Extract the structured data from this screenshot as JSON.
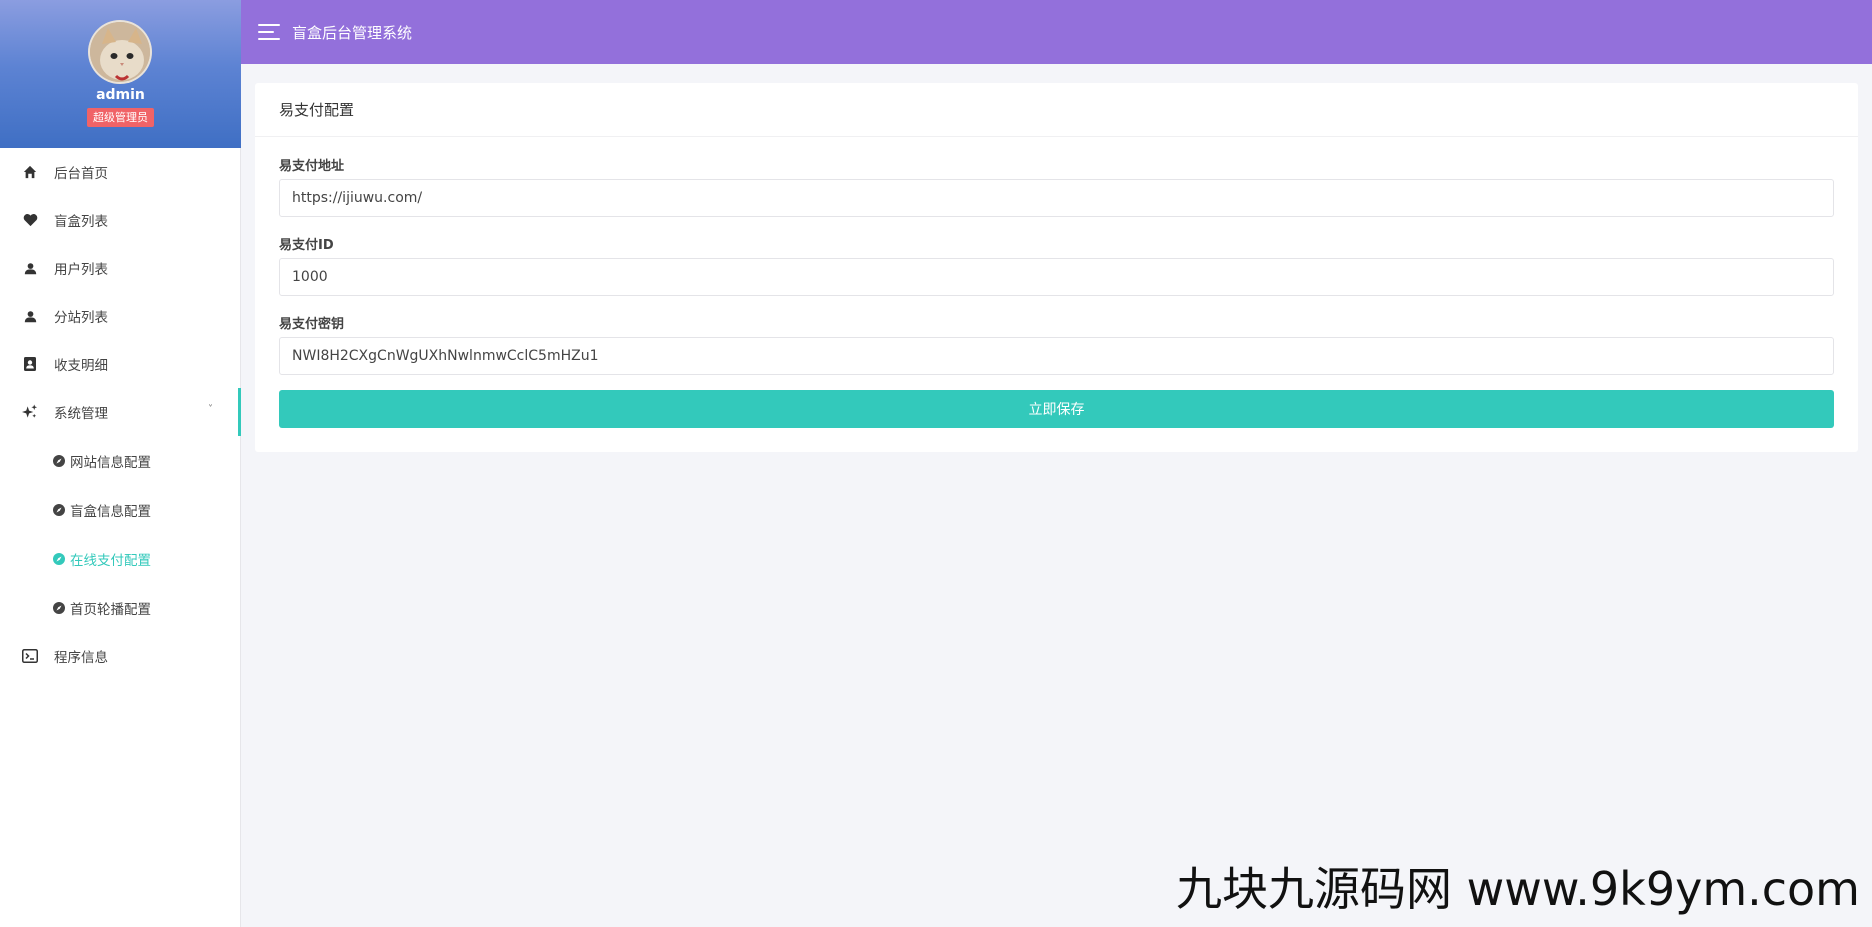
{
  "header": {
    "title": "盲盒后台管理系统"
  },
  "profile": {
    "name": "admin",
    "role": "超级管理员"
  },
  "sidebar": {
    "items": [
      {
        "label": "后台首页",
        "icon": "home-icon"
      },
      {
        "label": "盲盒列表",
        "icon": "heart-icon"
      },
      {
        "label": "用户列表",
        "icon": "user-icon"
      },
      {
        "label": "分站列表",
        "icon": "user-icon"
      },
      {
        "label": "收支明细",
        "icon": "contacts-icon"
      },
      {
        "label": "系统管理",
        "icon": "sparkle-icon",
        "expanded": true
      },
      {
        "label": "程序信息",
        "icon": "terminal-icon"
      }
    ],
    "submenu": [
      {
        "label": "网站信息配置"
      },
      {
        "label": "盲盒信息配置"
      },
      {
        "label": "在线支付配置",
        "active": true
      },
      {
        "label": "首页轮播配置"
      }
    ]
  },
  "card": {
    "title": "易支付配置",
    "fields": [
      {
        "label": "易支付地址",
        "value": "https://ijiuwu.com/"
      },
      {
        "label": "易支付ID",
        "value": "1000"
      },
      {
        "label": "易支付密钥",
        "value": "NWI8H2CXgCnWgUXhNwlnmwCclC5mHZu1"
      }
    ],
    "save_label": "立即保存"
  },
  "watermark": "九块九源码网 www.9k9ym.com",
  "colors": {
    "topbar": "#9370db",
    "accent": "#33c9bb",
    "badge": "#f06367"
  }
}
